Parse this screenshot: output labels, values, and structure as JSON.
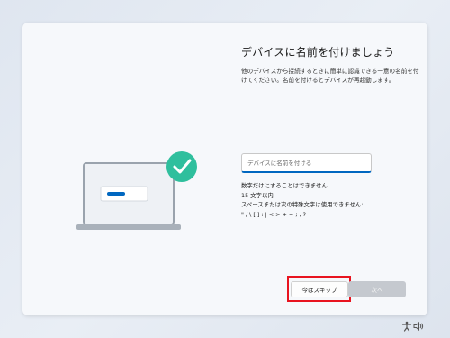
{
  "page": {
    "title": "デバイスに名前を付けましょう",
    "description": "他のデバイスから接続するときに簡単に認識できる一意の名前を付けてください。名前を付けるとデバイスが再起動します。"
  },
  "name_input": {
    "placeholder": "デバイスに名前を付ける",
    "value": ""
  },
  "rules": [
    "数字だけにすることはできません",
    "15 文字以内",
    "スペースまたは次の特殊文字は使用できません:",
    "\" / \\ [ ] : | < > + = ; , ?"
  ],
  "buttons": {
    "skip_label": "今はスキップ",
    "next_label": "次へ"
  },
  "colors": {
    "accent": "#0067c0",
    "check_circle": "#2fbf9d",
    "highlight_box": "#e8141f",
    "disabled_button": "#c5c9cf"
  },
  "icons": {
    "check": "checkmark-icon",
    "accessibility": "accessibility-icon",
    "volume": "volume-icon"
  }
}
